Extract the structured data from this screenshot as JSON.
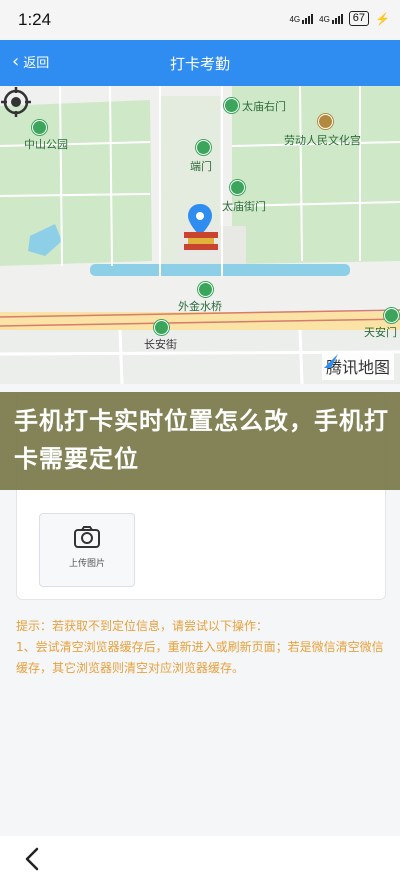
{
  "status_bar": {
    "time": "1:24",
    "signal_1": "4G",
    "signal_2": "4G",
    "battery": "67"
  },
  "nav": {
    "back_label": "返回",
    "title": "打卡考勤"
  },
  "map": {
    "labels": {
      "taimiao_north": "太庙右门",
      "zhongshan_park": "中山公园",
      "culture_palace": "劳动人民文化宫",
      "duanmen": "端门",
      "taimiao_street": "太庙街门",
      "waijin_bridge": "外金水桥",
      "changan_street": "长安街",
      "tiananmen_east": "天安门"
    },
    "brand": "腾讯地图"
  },
  "form": {
    "upload_label": "上传图片"
  },
  "overlay": {
    "headline": "手机打卡实时位置怎么改，手机打卡需要定位"
  },
  "tips": {
    "line1": "提示：若获取不到定位信息，请尝试以下操作：",
    "line2": "1、尝试清空浏览器缓存后，重新进入或刷新页面；若是微信清空微信缓存，其它浏览器则清空对应浏览器缓存。"
  },
  "colors": {
    "nav_blue": "#2f8cf0",
    "tip_orange": "#e8a13c",
    "overlay_olive": "#7a7a4a"
  }
}
